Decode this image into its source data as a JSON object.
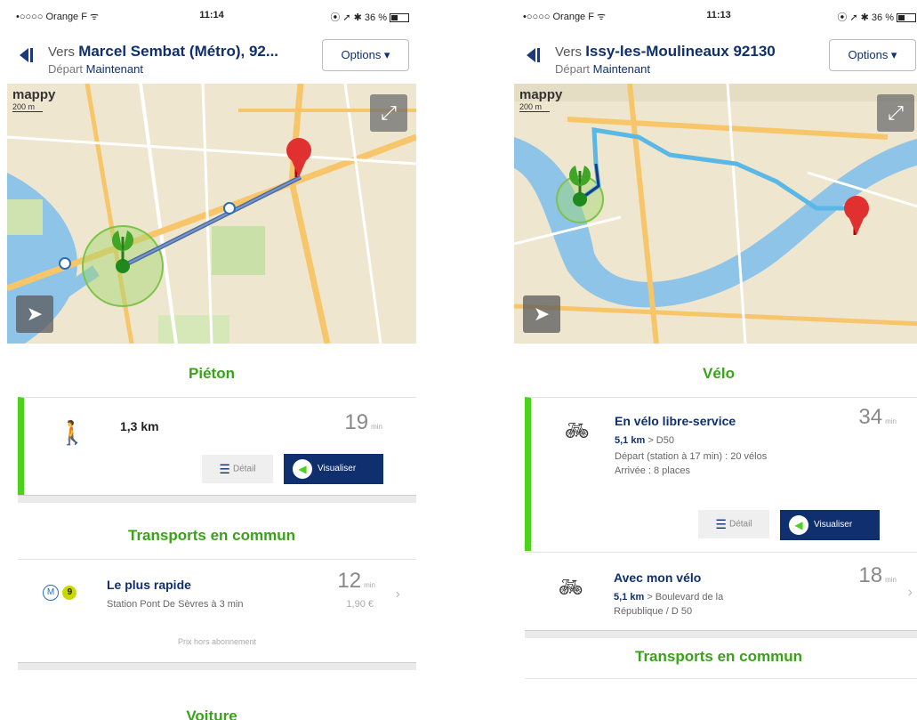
{
  "left": {
    "status": {
      "carrier": "•○○○○ Orange F ᯤ",
      "time": "11:14",
      "battery": "⦿ ➚ ✱ 36 %"
    },
    "header": {
      "vers": "Vers",
      "destination": "Marcel Sembat (Métro), 92...",
      "depart_label": "Départ",
      "depart_value": "Maintenant",
      "options": "Options ▾"
    },
    "map": {
      "logo": "mappy",
      "scale": "200 m"
    },
    "section1": {
      "title": "Piéton"
    },
    "walk": {
      "distance": "1,3 km",
      "duration": "19",
      "unit": "min",
      "detail": "Détail",
      "visualiser": "Visualiser"
    },
    "section2": {
      "title": "Transports en commun"
    },
    "transit": {
      "title": "Le plus rapide",
      "subtitle": "Station Pont De Sèvres à 3 min",
      "duration": "12",
      "unit": "min",
      "price": "1,90 €",
      "note": "Prix hors abonnement"
    },
    "section3": {
      "title": "Voiture"
    }
  },
  "right": {
    "status": {
      "carrier": "•○○○○ Orange F ᯤ",
      "time": "11:13",
      "battery": "⦿ ➚ ✱ 36 %"
    },
    "header": {
      "vers": "Vers",
      "destination": "Issy-les-Moulineaux 92130",
      "depart_label": "Départ",
      "depart_value": "Maintenant",
      "options": "Options ▾"
    },
    "map": {
      "logo": "mappy",
      "scale": "200 m"
    },
    "section1": {
      "title": "Vélo"
    },
    "bike1": {
      "title": "En vélo libre-service",
      "distance": "5,1 km",
      "road": "> D50",
      "line1": "Départ (station à 17 min) : 20 vélos",
      "line2": "Arrivée : 8 places",
      "duration": "34",
      "unit": "min",
      "detail": "Détail",
      "visualiser": "Visualiser"
    },
    "bike2": {
      "title": "Avec mon vélo",
      "distance": "5,1 km",
      "road": "> Boulevard de la",
      "road2": "République / D 50",
      "duration": "18",
      "unit": "min"
    },
    "section2": {
      "title": "Transports en commun"
    }
  },
  "colors": {
    "accent_green": "#4bd31a",
    "brand_navy": "#0f2f6f",
    "route_walk": "#5a7bb0",
    "route_bike": "#5ab8e6"
  }
}
